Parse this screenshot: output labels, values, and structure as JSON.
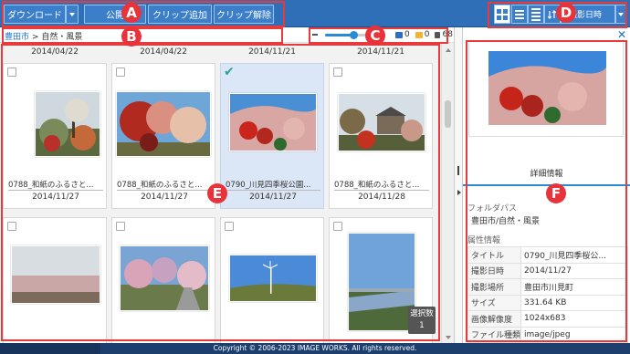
{
  "toolbar": {
    "download_label": "ダウンロード",
    "publish_label": "公開",
    "add_clip_label": "クリップ追加",
    "remove_clip_label": "クリップ解除",
    "sort_label": "撮影日時"
  },
  "breadcrumb": {
    "root": "豊田市",
    "separator": ">",
    "current": "自然・風景"
  },
  "zoom": {
    "level": 0.6
  },
  "counts": {
    "folders_blue": "0",
    "folders_yellow": "0",
    "files": "68"
  },
  "top_dates": [
    "2014/04/22",
    "2014/04/22",
    "2014/11/21",
    "2014/11/21"
  ],
  "items": [
    {
      "name": "0788_和紙のふるさと...",
      "date": "2014/11/27",
      "selected": false
    },
    {
      "name": "0788_和紙のふるさと...",
      "date": "2014/11/27",
      "selected": false
    },
    {
      "name": "0790_川見四季桜公園...",
      "date": "2014/11/27",
      "selected": true
    },
    {
      "name": "0788_和紙のふるさと...",
      "date": "2014/11/28",
      "selected": false
    }
  ],
  "selection": {
    "label": "選択数",
    "count": "1"
  },
  "annotations": [
    "A",
    "B",
    "C",
    "D",
    "E",
    "F"
  ],
  "detail": {
    "tab_label": "詳細情報",
    "folder_path_label": "フォルダパス",
    "folder_path_value": "豊田市/自然・風景",
    "attributes_label": "属性情報",
    "rows": [
      {
        "key": "タイトル",
        "value": "0790_川見四季桜公..."
      },
      {
        "key": "撮影日時",
        "value": "2014/11/27"
      },
      {
        "key": "撮影場所",
        "value": "豊田市川見町"
      },
      {
        "key": "サイズ",
        "value": "331.64 KB"
      },
      {
        "key": "画像解像度",
        "value": "1024x683"
      },
      {
        "key": "ファイル種類",
        "value": "image/jpeg"
      }
    ]
  },
  "footer": {
    "copyright": "Copyright © 2006-2023 IMAGE WORKS. All rights reserved."
  },
  "colors": {
    "toolbar": "#2f6fb8",
    "accent": "#2b8ad4",
    "annotation": "#e8333a",
    "selected_bg": "#dbe6f6"
  }
}
